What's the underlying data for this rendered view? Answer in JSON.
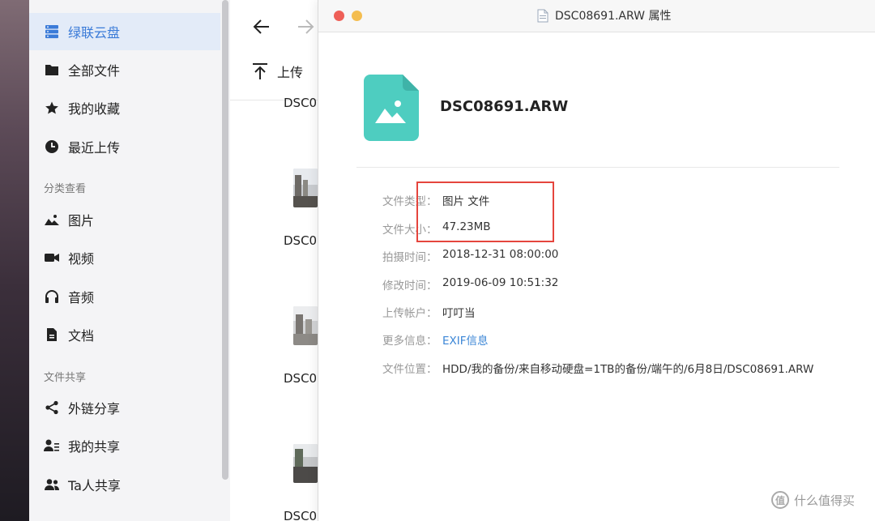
{
  "sidebar": {
    "items": [
      {
        "label": "绿联云盘",
        "icon": "storage-icon",
        "active": true
      },
      {
        "label": "全部文件",
        "icon": "folder-icon"
      },
      {
        "label": "我的收藏",
        "icon": "star-icon"
      },
      {
        "label": "最近上传",
        "icon": "clock-icon"
      }
    ],
    "section_category": "分类查看",
    "category_items": [
      {
        "label": "图片",
        "icon": "image-icon"
      },
      {
        "label": "视频",
        "icon": "video-icon"
      },
      {
        "label": "音频",
        "icon": "headphones-icon"
      },
      {
        "label": "文档",
        "icon": "document-icon"
      }
    ],
    "section_share": "文件共享",
    "share_items": [
      {
        "label": "外链分享",
        "icon": "share-icon"
      },
      {
        "label": "我的共享",
        "icon": "user-share-icon"
      },
      {
        "label": "Ta人共享",
        "icon": "users-icon"
      }
    ]
  },
  "filelist": {
    "upload_label": "上传",
    "files": [
      "DSC0",
      "DSC0",
      "DSC0",
      "DSC0"
    ]
  },
  "window": {
    "title": "DSC08691.ARW 属性",
    "file_name": "DSC08691.ARW",
    "properties": [
      {
        "label": "文件类型：",
        "value": "图片 文件"
      },
      {
        "label": "文件大小：",
        "value": "47.23MB"
      },
      {
        "label": "拍摄时间：",
        "value": "2018-12-31 08:00:00"
      },
      {
        "label": "修改时间：",
        "value": "2019-06-09 10:51:32"
      },
      {
        "label": "上传帐户：",
        "value": "叮叮当"
      },
      {
        "label": "更多信息：",
        "value": "EXIF信息",
        "link": true
      },
      {
        "label": "文件位置：",
        "value": "HDD/我的备份/来自移动硬盘=1TB的备份/端午的/6月8日/DSC08691.ARW"
      }
    ]
  },
  "watermark": {
    "text": "什么值得买",
    "logo": "值"
  },
  "colors": {
    "accent": "#3b7bd8",
    "highlight": "#e5453d",
    "file_icon": "#4ecdc0"
  }
}
